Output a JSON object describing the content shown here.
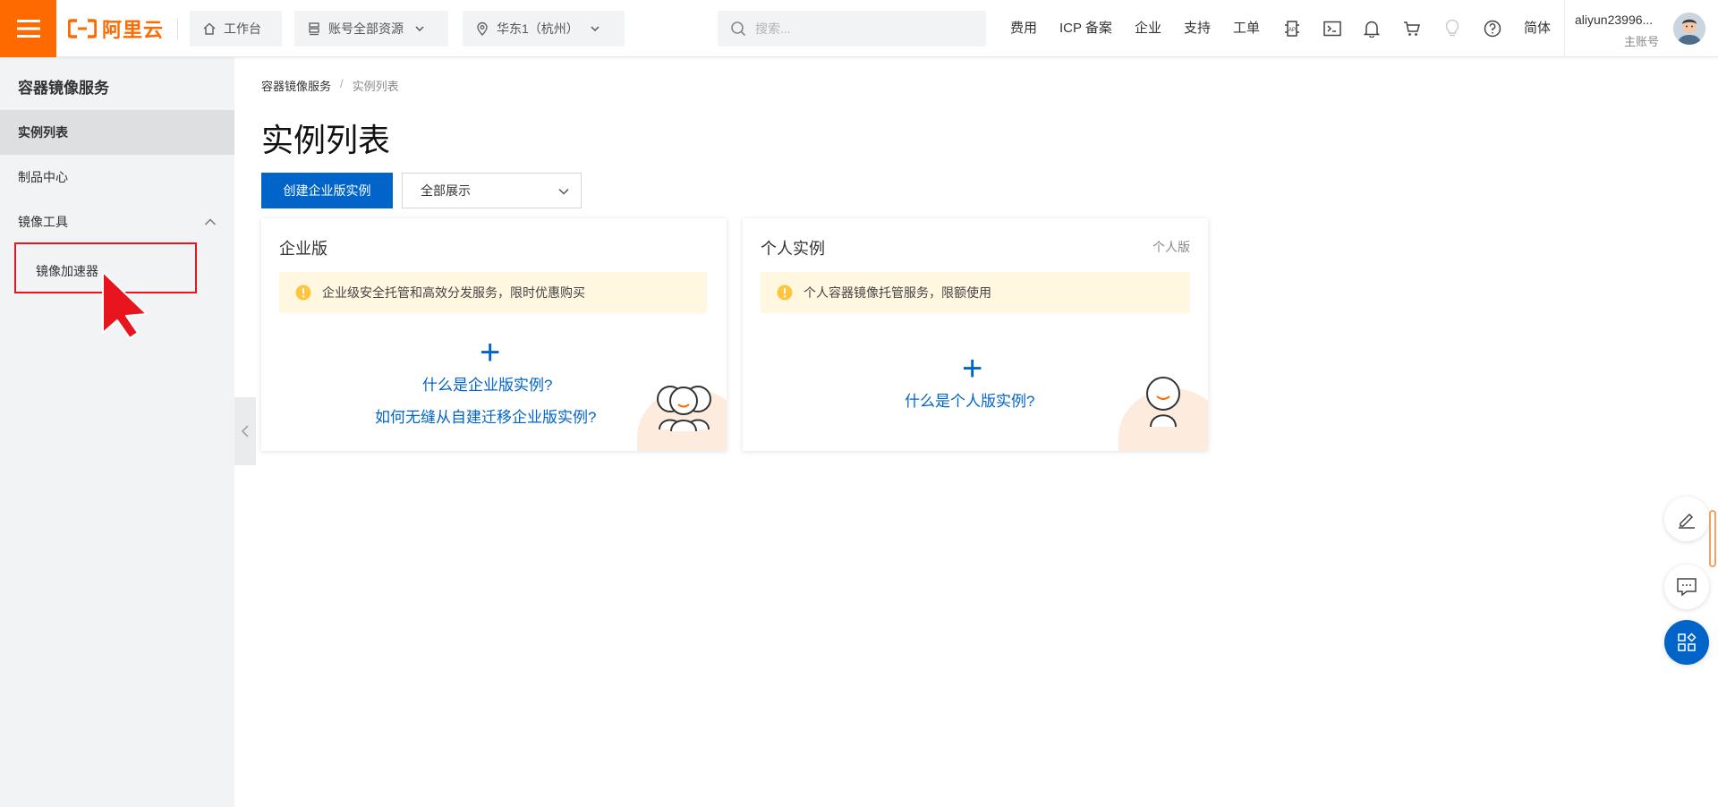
{
  "header": {
    "logo_text": "阿里云",
    "workbench": "工作台",
    "resources": "账号全部资源",
    "region": "华东1（杭州）",
    "search_placeholder": "搜索...",
    "links": [
      "费用",
      "ICP 备案",
      "企业",
      "支持",
      "工单"
    ],
    "lang": "简体",
    "user_name": "aliyun23996...",
    "user_role": "主账号"
  },
  "sidebar": {
    "title": "容器镜像服务",
    "items": [
      {
        "label": "实例列表"
      },
      {
        "label": "制品中心"
      },
      {
        "label": "镜像工具"
      }
    ],
    "sub_items": [
      {
        "label": "镜像加速器"
      }
    ]
  },
  "main": {
    "breadcrumb": [
      "容器镜像服务",
      "/",
      "实例列表"
    ],
    "title": "实例列表",
    "create_button": "创建企业版实例",
    "filter_select": "全部展示",
    "cards": [
      {
        "title": "企业版",
        "tag": "",
        "notice": "企业级安全托管和高效分发服务，限时优惠购买",
        "plus": "+",
        "links": [
          "什么是企业版实例?",
          "如何无缝从自建迁移企业版实例?"
        ]
      },
      {
        "title": "个人实例",
        "tag": "个人版",
        "notice": "个人容器镜像托管服务，限额使用",
        "plus": "+",
        "links": [
          "什么是个人版实例?"
        ]
      }
    ]
  },
  "colors": {
    "brand_orange": "#ff6a00",
    "primary_blue": "#0064c8",
    "highlight_red": "#e8151f",
    "notice_bg": "#fff7e0"
  }
}
